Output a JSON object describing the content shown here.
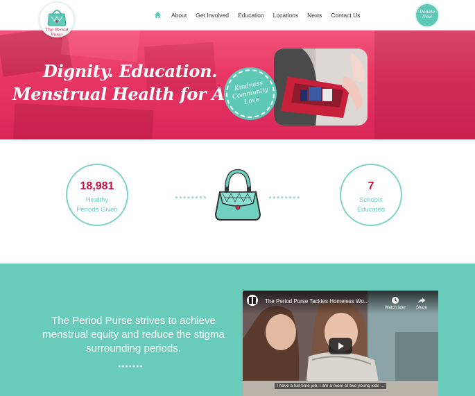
{
  "header": {
    "logo_text": "The Period Purse",
    "nav": [
      "About",
      "Get Involved",
      "Education",
      "Locations",
      "News",
      "Contact Us"
    ],
    "donate": "Donate Now"
  },
  "hero": {
    "headline_line1": "Dignity. Education.",
    "headline_line2": "Menstrual Health for All.",
    "badge": [
      "Kindness",
      "Community",
      "Love"
    ]
  },
  "stats": {
    "left": {
      "value": "18,981",
      "label_line1": "Healthy",
      "label_line2": "Periods Given"
    },
    "right": {
      "value": "7",
      "label_line1": "Schools",
      "label_line2": "Educated"
    }
  },
  "mission": {
    "text": "The Period Purse strives to achieve menstrual equity and reduce the stigma surrounding periods."
  },
  "video": {
    "title": "The Period Purse Tackles Homeless Wo...",
    "watch_later": "Watch later",
    "share": "Share",
    "caption": "I have a full-time job, I am a mom of two young kids ..."
  },
  "colors": {
    "teal": "#69cbb9",
    "pink": "#e93765",
    "stat_number": "#c8103f"
  }
}
